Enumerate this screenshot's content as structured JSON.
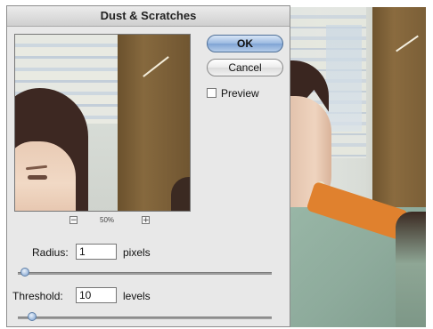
{
  "dialog": {
    "title": "Dust & Scratches",
    "ok_label": "OK",
    "cancel_label": "Cancel",
    "preview_label": "Preview",
    "preview_checked": false,
    "zoom": {
      "minus_glyph": "−",
      "plus_glyph": "+",
      "level": "50%"
    },
    "radius": {
      "label": "Radius:",
      "value": "1",
      "unit": "pixels",
      "slider_fraction": 0.01
    },
    "threshold": {
      "label": "Threshold:",
      "value": "10",
      "unit": "levels",
      "slider_fraction": 0.04
    }
  },
  "colors": {
    "accent": "#7fa3d4",
    "dialog_bg": "#e8e8e8"
  }
}
